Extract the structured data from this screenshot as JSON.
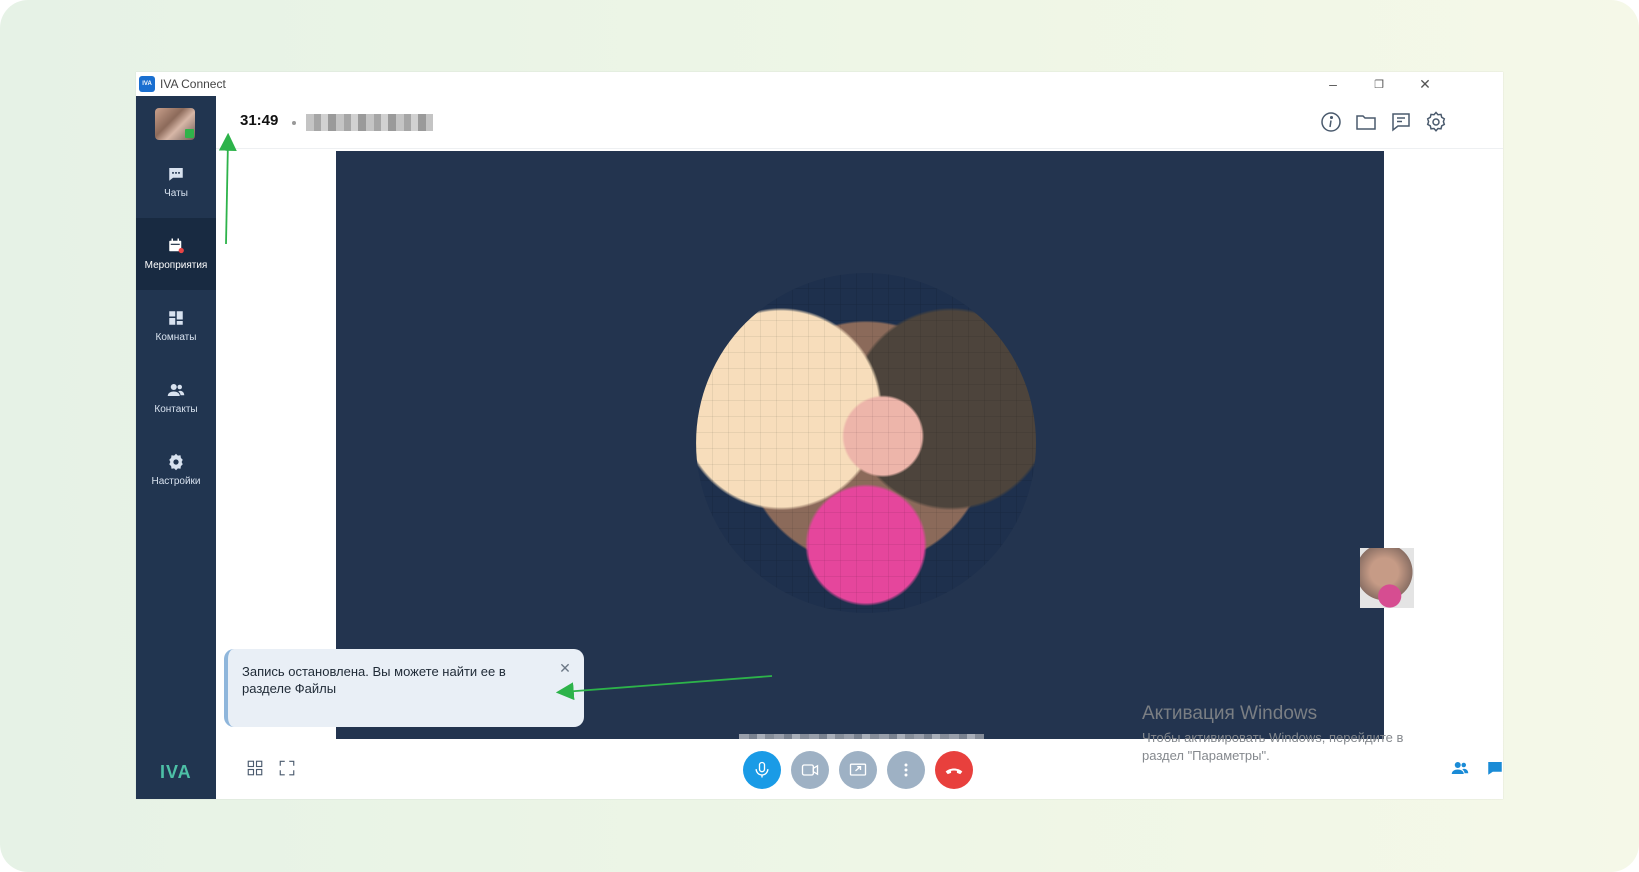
{
  "window": {
    "title": "IVA Connect",
    "logo_text": "IVA",
    "controls": {
      "minimize": "–",
      "restore": "❐",
      "close": "✕"
    }
  },
  "sidebar": {
    "items": [
      {
        "label": "Чаты",
        "icon": "chat-icon",
        "active": false
      },
      {
        "label": "Мероприятия",
        "icon": "calendar-live-icon",
        "active": true
      },
      {
        "label": "Комнаты",
        "icon": "rooms-icon",
        "active": false
      },
      {
        "label": "Контакты",
        "icon": "contacts-icon",
        "active": false
      },
      {
        "label": "Настройки",
        "icon": "settings-icon",
        "active": false
      }
    ],
    "logo": "IVA"
  },
  "topbar": {
    "timer": "31:49",
    "icons": [
      "info-icon",
      "folder-icon",
      "notes-icon",
      "gear-icon"
    ]
  },
  "toast": {
    "message": "Запись остановлена. Вы можете найти ее в разделе Файлы",
    "close": "✕"
  },
  "controls": {
    "left_icons": [
      "grid-layout-icon",
      "fullscreen-icon"
    ],
    "center": [
      "microphone-icon",
      "camera-icon",
      "screen-share-icon",
      "more-icon",
      "hangup-icon"
    ],
    "right_icons": [
      "participants-icon",
      "chat-bubble-icon"
    ]
  },
  "windows_activation": {
    "title": "Активация Windows",
    "subtitle_line1": "Чтобы активировать Windows, перейдите в",
    "subtitle_line2": "раздел \"Параметры\"."
  },
  "colors": {
    "sidebar": "#213550",
    "stage": "#23344f",
    "mic_active": "#1a9be6",
    "hangup": "#e8403d",
    "annotation_arrow": "#2db34a"
  }
}
